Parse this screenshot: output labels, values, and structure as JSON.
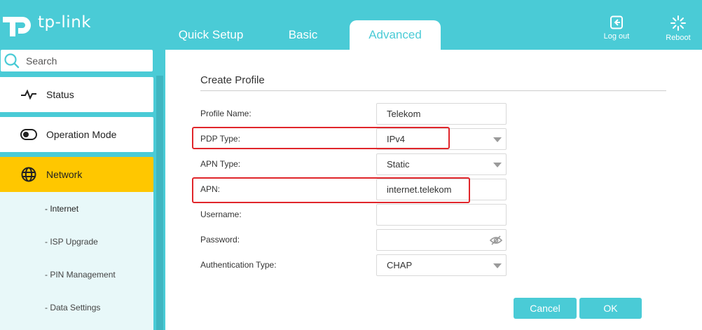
{
  "brand": {
    "name": "tp-link"
  },
  "tabs": [
    {
      "label": "Quick Setup"
    },
    {
      "label": "Basic"
    },
    {
      "label": "Advanced"
    }
  ],
  "header_buttons": {
    "logout": "Log out",
    "reboot": "Reboot"
  },
  "sidebar": {
    "search_label": "Search",
    "items": [
      {
        "label": "Status",
        "icon": "pulse-icon"
      },
      {
        "label": "Operation Mode",
        "icon": "toggle-icon"
      },
      {
        "label": "Network",
        "icon": "globe-icon",
        "active": true
      }
    ],
    "sub_items": [
      {
        "label": "- Internet",
        "active": true
      },
      {
        "label": "- ISP Upgrade"
      },
      {
        "label": "- PIN Management"
      },
      {
        "label": "- Data Settings"
      }
    ]
  },
  "form": {
    "title": "Create Profile",
    "fields": {
      "profile_name": {
        "label": "Profile Name:",
        "value": "Telekom"
      },
      "pdp_type": {
        "label": "PDP Type:",
        "value": "IPv4"
      },
      "apn_type": {
        "label": "APN Type:",
        "value": "Static"
      },
      "apn": {
        "label": "APN:",
        "value": "internet.telekom"
      },
      "username": {
        "label": "Username:",
        "value": ""
      },
      "password": {
        "label": "Password:",
        "value": ""
      },
      "auth_type": {
        "label": "Authentication Type:",
        "value": "CHAP"
      }
    },
    "cancel_label": "Cancel",
    "ok_label": "OK"
  },
  "colors": {
    "accent": "#4acbd6",
    "active_nav": "#ffc700",
    "highlight": "#e0262b"
  }
}
